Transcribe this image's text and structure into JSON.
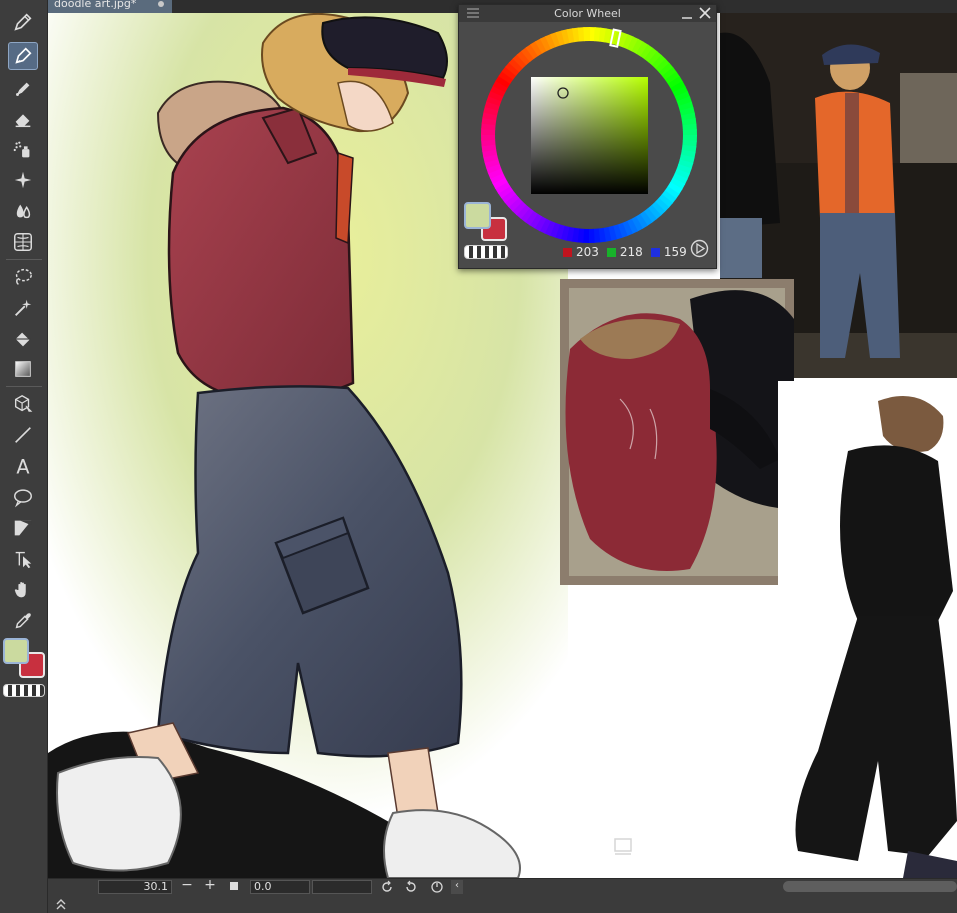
{
  "document_tab": {
    "title": "doodle art.jpg*"
  },
  "color_wheel": {
    "title": "Color Wheel",
    "rgb": {
      "r": "203",
      "g": "218",
      "b": "159"
    }
  },
  "colors": {
    "foreground": "#cbda9f",
    "background": "#c8303f",
    "accent": "#566b85"
  },
  "navigator": {
    "zoom": "30.1",
    "zoom_out": "−",
    "zoom_in": "+",
    "angle": "0.0",
    "flip": "‹"
  },
  "tools": [
    "pen-nib-icon",
    "pen-icon",
    "marker-icon",
    "eraser-icon",
    "airbrush-icon",
    "sparkle-icon",
    "blend-icon",
    "grid-icon",
    "lasso-icon",
    "magic-wand-icon",
    "fill-bucket-icon",
    "gradient-icon",
    "3d-object-icon",
    "line-icon",
    "text-icon",
    "speech-balloon-icon",
    "frame-icon",
    "operation-icon",
    "hand-icon",
    "eyedropper-icon"
  ]
}
